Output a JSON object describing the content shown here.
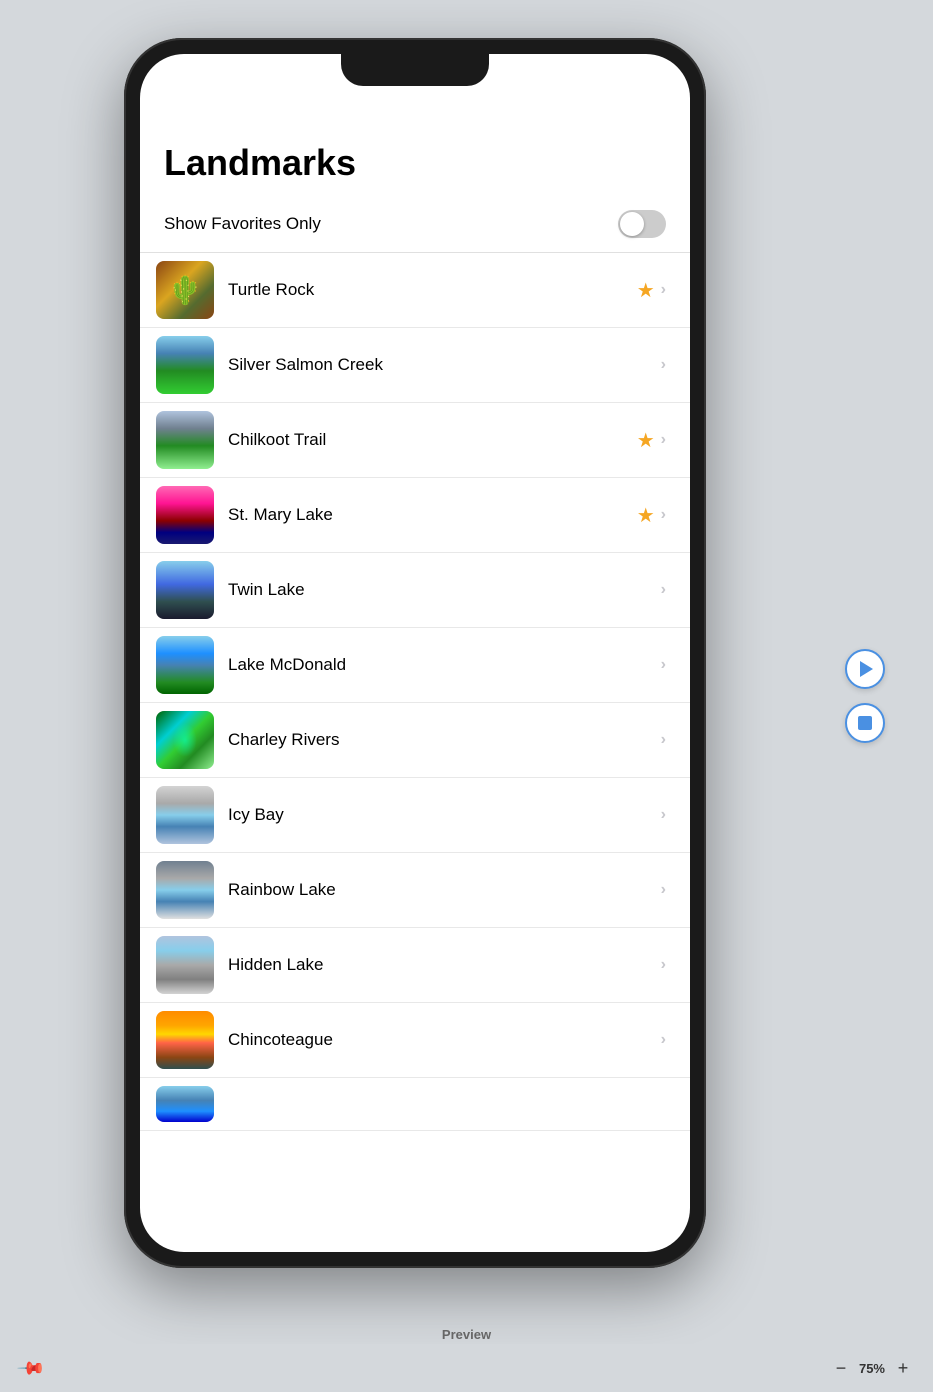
{
  "app": {
    "preview_label": "Preview",
    "zoom": "75%"
  },
  "page": {
    "title": "Landmarks"
  },
  "favorites_toggle": {
    "label": "Show Favorites Only",
    "enabled": false
  },
  "landmarks": [
    {
      "id": "turtle-rock",
      "name": "Turtle Rock",
      "favorite": true,
      "img_class": "img-turtle-rock"
    },
    {
      "id": "silver-salmon-creek",
      "name": "Silver Salmon Creek",
      "favorite": false,
      "img_class": "img-silver-salmon"
    },
    {
      "id": "chilkoot-trail",
      "name": "Chilkoot Trail",
      "favorite": true,
      "img_class": "img-chilkoot"
    },
    {
      "id": "st-mary-lake",
      "name": "St. Mary Lake",
      "favorite": true,
      "img_class": "img-st-mary"
    },
    {
      "id": "twin-lake",
      "name": "Twin Lake",
      "favorite": false,
      "img_class": "img-twin-lake"
    },
    {
      "id": "lake-mcdonald",
      "name": "Lake McDonald",
      "favorite": false,
      "img_class": "img-lake-mcdonald"
    },
    {
      "id": "charley-rivers",
      "name": "Charley Rivers",
      "favorite": false,
      "img_class": "img-charley-rivers"
    },
    {
      "id": "icy-bay",
      "name": "Icy Bay",
      "favorite": false,
      "img_class": "img-icy-bay"
    },
    {
      "id": "rainbow-lake",
      "name": "Rainbow Lake",
      "favorite": false,
      "img_class": "img-rainbow-lake"
    },
    {
      "id": "hidden-lake",
      "name": "Hidden Lake",
      "favorite": false,
      "img_class": "img-hidden-lake"
    },
    {
      "id": "chincoteague",
      "name": "Chincoteague",
      "favorite": false,
      "img_class": "img-chincoteague"
    },
    {
      "id": "last-item",
      "name": "",
      "favorite": false,
      "img_class": "img-last"
    }
  ],
  "toolbar": {
    "zoom_minus": "−",
    "zoom_level": "75%",
    "zoom_plus": "+"
  }
}
